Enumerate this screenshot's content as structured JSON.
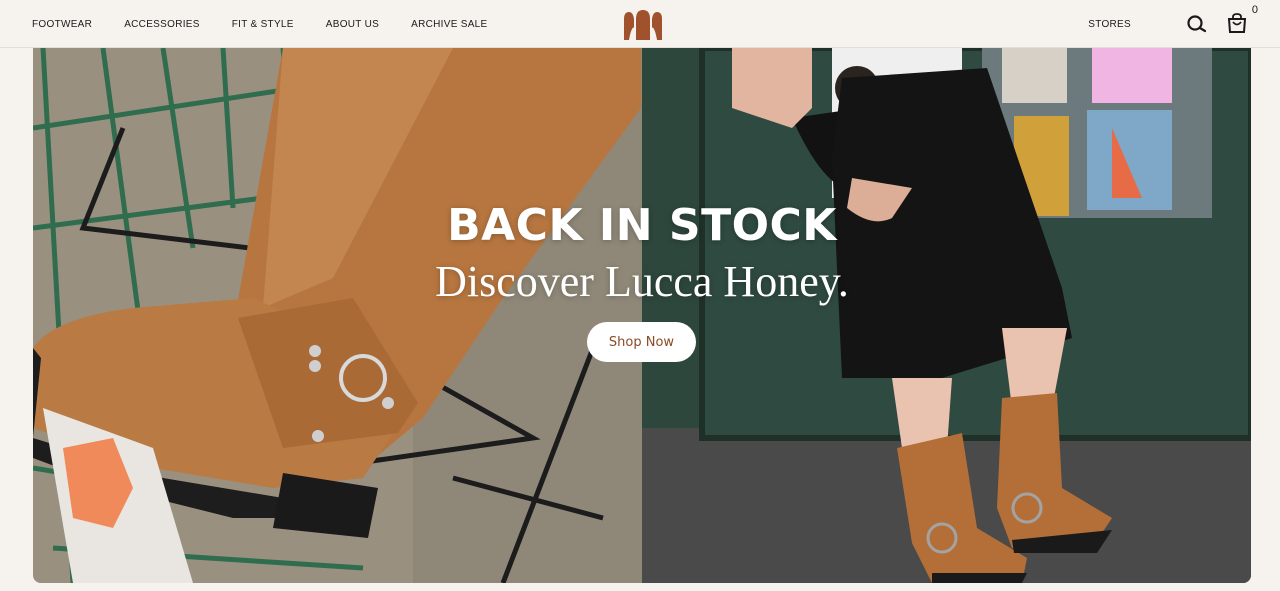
{
  "header": {
    "nav": [
      "FOOTWEAR",
      "ACCESSORIES",
      "FIT & STYLE",
      "ABOUT US",
      "ARCHIVE SALE"
    ],
    "stores_label": "STORES",
    "bag_count": "0",
    "logo_color": "#a0522d"
  },
  "hero": {
    "kicker": "BACK IN STOCK",
    "title": "Discover Lucca Honey.",
    "button_label": "Shop Now",
    "button_text_color": "#8a4b24"
  }
}
